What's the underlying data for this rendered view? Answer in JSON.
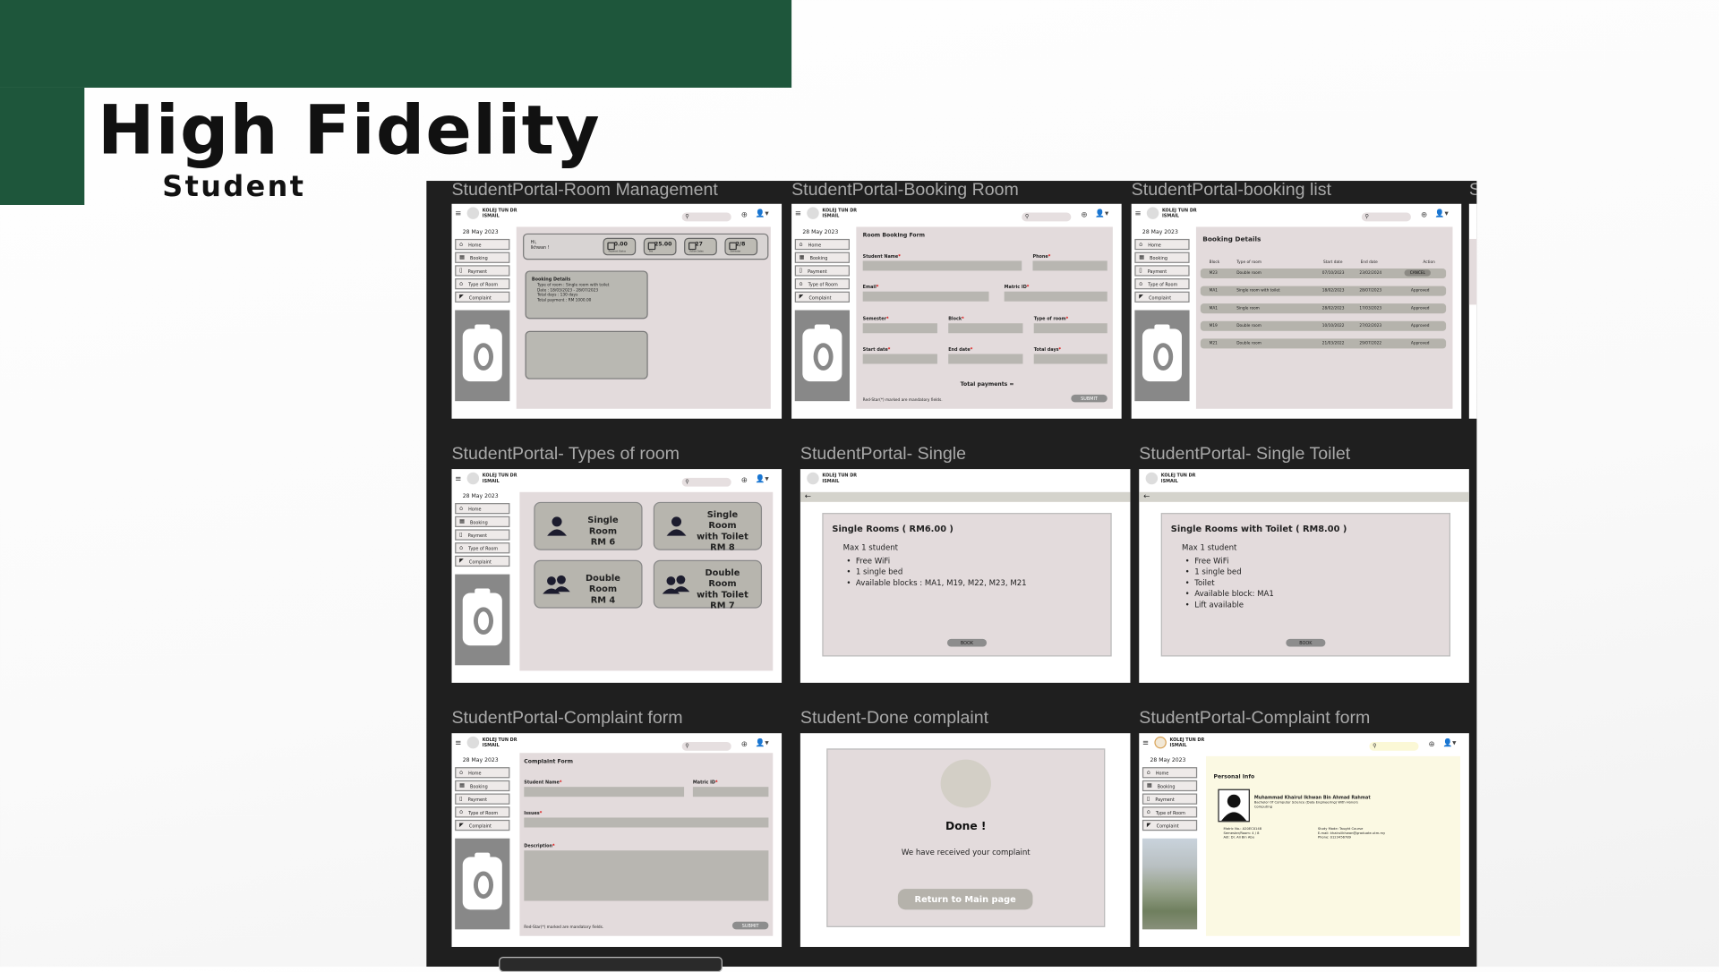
{
  "slide": {
    "title": "High Fidelity",
    "subtitle": "Student"
  },
  "colors": {
    "accent": "#1e563b",
    "board": "#1f1f1f",
    "content_bg": "#e3dbdc",
    "field": "#b8b6b1"
  },
  "frames": {
    "labels": [
      "StudentPortal-Room Management",
      "StudentPortal-Booking Room",
      "StudentPortal-booking list",
      "StudentPortal- Types of room",
      "StudentPortal- Single",
      "StudentPortal- Single Toilet",
      "StudentPortal-Complaint form",
      "Student-Done complaint",
      "StudentPortal-Complaint form"
    ]
  },
  "app": {
    "brand_line1": "KOLEJ TUN DR",
    "brand_line2": "ISMAIL",
    "date": "28 May 2023",
    "sidebar": [
      "Home",
      "Booking",
      "Payment",
      "Type of Room",
      "Complaint"
    ],
    "sidebar_icons": [
      "home-icon",
      "booking-icon",
      "payment-icon",
      "room-type-icon",
      "complaint-icon"
    ]
  },
  "room_management": {
    "greeting1": "Hi,",
    "greeting2": "Ikhwan !",
    "stats": [
      {
        "value": "0.00",
        "label": "Payment Status"
      },
      {
        "value": "25.00",
        "label": "Fee"
      },
      {
        "value": "27",
        "label": "Active Dates"
      },
      {
        "value": "2/8",
        "label": "Semester"
      }
    ],
    "booking_title": "Booking Details",
    "booking_lines": [
      "Type of room : Single room with toilet",
      "Date : 18/03/2023 - 28/07/2023",
      "Total days : 130 days",
      "Total payment : RM 1000.00"
    ]
  },
  "booking_room": {
    "title": "Room Booking Form",
    "labels": [
      "Student Name",
      "Phone",
      "Email",
      "Matric ID",
      "Semester",
      "Block",
      "Type of room",
      "Start date",
      "End date",
      "Total days"
    ],
    "total": "Total payments =",
    "submit": "SUBMIT",
    "note": "Red-Star(*) marked are mandatory fields."
  },
  "booking_list": {
    "title": "Booking Details",
    "headers": [
      "Block",
      "Type of room",
      "Start date",
      "End date",
      "Action"
    ],
    "rows": [
      [
        "M23",
        "Double room",
        "07/10/2023",
        "23/02/2024",
        "CANCEL"
      ],
      [
        "MA1",
        "Single room with toilet",
        "18/02/2023",
        "28/07/2023",
        "Approved"
      ],
      [
        "MA1",
        "Single room",
        "28/02/2023",
        "17/03/2023",
        "Approved"
      ],
      [
        "M19",
        "Double room",
        "10/10/2022",
        "27/02/2023",
        "Approved"
      ],
      [
        "M21",
        "Double room",
        "21/03/2022",
        "29/07/2022",
        "Approved"
      ]
    ]
  },
  "types_of_room": {
    "cards": [
      {
        "line1": "Single Room",
        "line2": "",
        "price": "RM 6"
      },
      {
        "line1": "Single Room",
        "line2": "with Toilet",
        "price": "RM 8"
      },
      {
        "line1": "Double Room",
        "line2": "",
        "price": "RM 4"
      },
      {
        "line1": "Double Room",
        "line2": "with Toilet",
        "price": "RM 7"
      }
    ]
  },
  "single": {
    "title": "Single Rooms ( RM6.00 )",
    "max": "Max 1 student",
    "items": [
      "Free WiFi",
      "1 single bed",
      "Available blocks : MA1, M19, M22, M23, M21"
    ],
    "book": "BOOK"
  },
  "single_toilet": {
    "title": "Single Rooms with Toilet ( RM8.00 )",
    "max": "Max 1 student",
    "items": [
      "Free WiFi",
      "1 single bed",
      "Toilet",
      "Available block: MA1",
      "Lift available"
    ],
    "book": "BOOK"
  },
  "complaint": {
    "title": "Complaint Form",
    "labels": [
      "Student Name",
      "Matric ID",
      "Issues",
      "Description"
    ],
    "submit": "SUBMIT",
    "note": "Red-Star(*) marked are mandatory fields."
  },
  "done": {
    "title": "Done !",
    "message": "We have received your complaint",
    "button": "Return to Main page"
  },
  "personal": {
    "title": "Personal Info",
    "name": "Muhammad Khairul Ikhwan Bin Ahmad Rahmat",
    "program": "Bachelor Of Computer Science (Data Engineering) With Honors",
    "campus": "Computing",
    "left": [
      "Matric No.: A20EC0148",
      "Semester/Room: 4 / 8",
      "Adi: Dr. Ali Bin Abu"
    ],
    "right": [
      "Study Mode: Taught Course",
      "E-mail: khairulikhwan@graduate.utm.my",
      "Phone: 0123456789"
    ]
  }
}
